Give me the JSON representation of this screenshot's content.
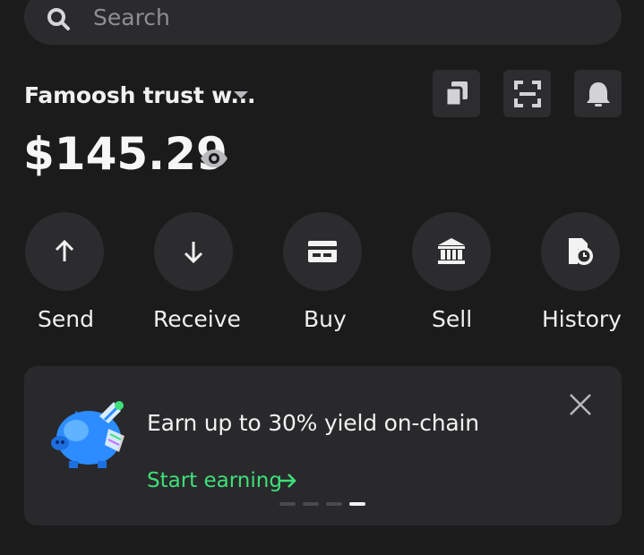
{
  "search": {
    "placeholder": "Search",
    "icon": "search-icon"
  },
  "wallet": {
    "name": "Famoosh trust w...",
    "balance": "$145.29"
  },
  "top_buttons": [
    {
      "icon": "copy-icon"
    },
    {
      "icon": "scan-icon"
    },
    {
      "icon": "bell-icon"
    }
  ],
  "actions": [
    {
      "label": "Send",
      "icon": "arrow-up-icon"
    },
    {
      "label": "Receive",
      "icon": "arrow-down-icon"
    },
    {
      "label": "Buy",
      "icon": "card-icon"
    },
    {
      "label": "Sell",
      "icon": "bank-icon"
    },
    {
      "label": "History",
      "icon": "history-icon"
    }
  ],
  "promo": {
    "title": "Earn up to 30% yield on-chain",
    "cta": "Start earning",
    "carousel_total": 4,
    "carousel_active": 4,
    "accent_color": "#3ee07a"
  },
  "colors": {
    "background": "#1b1b1c",
    "surface": "#2c2c2e",
    "text": "#f4f4f5",
    "muted": "#8e8e93",
    "accent": "#3ee07a"
  }
}
